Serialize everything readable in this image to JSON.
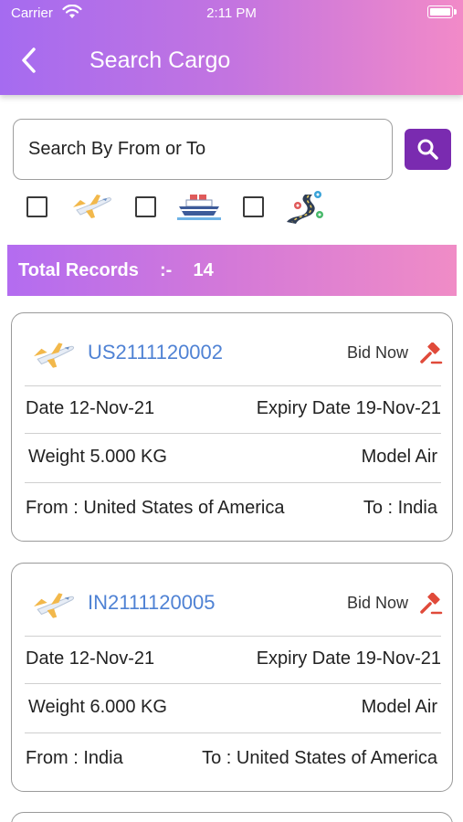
{
  "status_bar": {
    "carrier": "Carrier",
    "time": "2:11 PM",
    "battery_level": 1.0
  },
  "header": {
    "title": "Search Cargo",
    "back_icon": "chevron-left-icon"
  },
  "search": {
    "placeholder": "Search By From or To",
    "button_icon": "search-icon"
  },
  "filters": [
    {
      "mode": "Air",
      "checked": false,
      "icon": "airplane-icon"
    },
    {
      "mode": "Sea",
      "checked": false,
      "icon": "ship-icon"
    },
    {
      "mode": "Road",
      "checked": false,
      "icon": "road-icon"
    }
  ],
  "summary": {
    "label": "Total Records",
    "separator": ":-",
    "count": "14"
  },
  "cargo": [
    {
      "id": "US2111120002",
      "bid_label": "Bid Now",
      "date": "Date 12-Nov-21",
      "expiry": "Expiry Date 19-Nov-21",
      "weight": "Weight 5.000 KG",
      "model": "Model  Air",
      "from": "From : United States of America",
      "to": "To : India"
    },
    {
      "id": "IN2111120005",
      "bid_label": "Bid Now",
      "date": "Date 12-Nov-21",
      "expiry": "Expiry Date 19-Nov-21",
      "weight": "Weight 6.000 KG",
      "model": "Model  Air",
      "from": "From : India",
      "to": "To : United States of America"
    }
  ],
  "colors": {
    "accent": "#7a2bb0",
    "id_link": "#4f82d4",
    "gradient_start": "#a56bf0",
    "gradient_end": "#f28ac8",
    "bid_icon": "#e04a3a"
  }
}
